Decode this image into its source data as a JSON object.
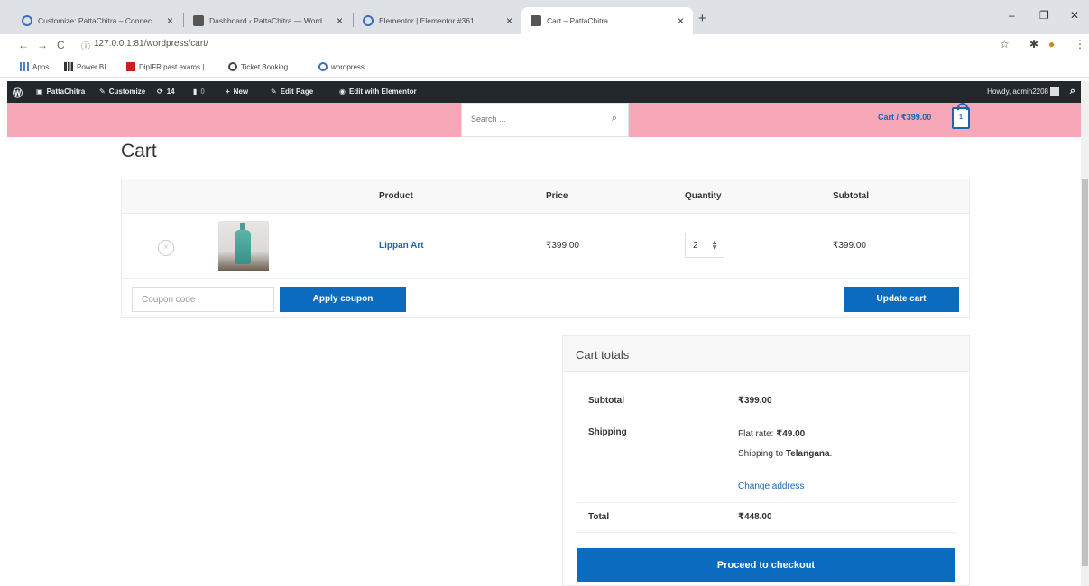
{
  "browser": {
    "tabs": [
      {
        "title": "Customize: PattaChitra – Connec…"
      },
      {
        "title": "Dashboard ‹ PattaChitra — Word…"
      },
      {
        "title": "Elementor | Elementor #361"
      },
      {
        "title": "Cart – PattaChitra"
      }
    ],
    "url": "127.0.0.1:81/wordpress/cart/"
  },
  "bookmarks": [
    {
      "label": "Apps",
      "icon": "apps-grid-icon"
    },
    {
      "label": "Power BI",
      "icon": "power-bi-icon"
    },
    {
      "label": "DipIFR past exams |...",
      "icon": "bookmark-red-icon"
    },
    {
      "label": "Ticket Booking",
      "icon": "globe-icon"
    },
    {
      "label": "wordpress",
      "icon": "wordpress-icon"
    }
  ],
  "wp_admin_bar": {
    "site_name": "PattaChitra",
    "customize": "Customize",
    "updates_count": "14",
    "comments_count": "0",
    "new": "New",
    "edit_page": "Edit Page",
    "edit_elementor": "Edit with Elementor",
    "howdy": "Howdy, admin2208"
  },
  "header": {
    "search_placeholder": "Search ...",
    "cart_label": "Cart / ₹399.00",
    "cart_count": "1"
  },
  "page_title": "Cart",
  "cart_table": {
    "headers": {
      "product": "Product",
      "price": "Price",
      "quantity": "Quantity",
      "subtotal": "Subtotal"
    },
    "items": [
      {
        "remove": "×",
        "name": "Lippan Art",
        "price": "₹399.00",
        "quantity": "2",
        "subtotal": "₹399.00"
      }
    ],
    "coupon_placeholder": "Coupon code",
    "apply_coupon": "Apply coupon",
    "update_cart": "Update cart"
  },
  "cart_totals": {
    "title": "Cart totals",
    "subtotal_label": "Subtotal",
    "subtotal_value": "₹399.00",
    "shipping_label": "Shipping",
    "flat_rate_prefix": "Flat rate: ",
    "flat_rate_value": "₹49.00",
    "shipping_to_prefix": "Shipping to ",
    "shipping_to_state": "Telangana",
    "shipping_to_suffix": ".",
    "change_address": "Change address",
    "total_label": "Total",
    "total_value": "₹448.00",
    "checkout": "Proceed to checkout"
  },
  "colors": {
    "accent": "#0b6cbf",
    "header_bg": "#f7a8b8",
    "admin_bar": "#23282d",
    "link": "#1a66b5"
  }
}
